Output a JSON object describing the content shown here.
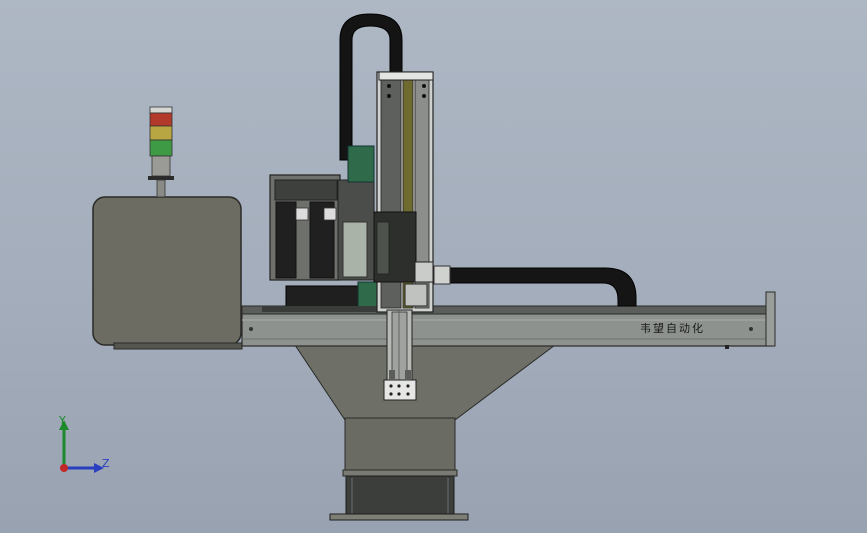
{
  "model": {
    "brand_label": "韦望自动化"
  },
  "triad": {
    "y_label": "Y",
    "z_label": "Z",
    "colors": {
      "y": "#1c8a2a",
      "z": "#2a3fbf",
      "x": "#c0282a"
    }
  },
  "colors": {
    "background": "#a3adbb",
    "frame": "#6c6c62",
    "dark_steel": "#3a3d3a",
    "rail": "#8e928e",
    "tower_red": "#b33a2a",
    "tower_yellow": "#b8a642",
    "tower_green": "#3f9a45",
    "motor_green": "#2f6b4a"
  }
}
